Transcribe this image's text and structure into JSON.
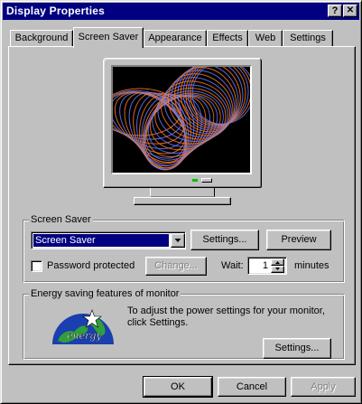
{
  "window": {
    "title": "Display Properties",
    "help_glyph": "?",
    "close_glyph": "✕"
  },
  "tabs": [
    {
      "label": "Background",
      "active": false
    },
    {
      "label": "Screen Saver",
      "active": true
    },
    {
      "label": "Appearance",
      "active": false
    },
    {
      "label": "Effects",
      "active": false
    },
    {
      "label": "Web",
      "active": false
    },
    {
      "label": "Settings",
      "active": false
    }
  ],
  "preview": {
    "colors": {
      "screen": "#000000",
      "accent_orange": "#ff7a1e",
      "accent_blue": "#6a7cff"
    }
  },
  "screen_saver_group": {
    "legend": "Screen Saver",
    "selected": "Screen Saver",
    "settings_label": "Settings...",
    "preview_label": "Preview",
    "password_label": "Password protected",
    "password_checked": false,
    "change_label": "Change...",
    "wait_label": "Wait:",
    "wait_value": "1",
    "minutes_label": "minutes"
  },
  "energy_group": {
    "legend": "Energy saving features of monitor",
    "description": "To adjust the power settings for your monitor, click Settings.",
    "settings_label": "Settings...",
    "logo_word": "energy"
  },
  "footer": {
    "ok_label": "OK",
    "cancel_label": "Cancel",
    "apply_label": "Apply"
  }
}
